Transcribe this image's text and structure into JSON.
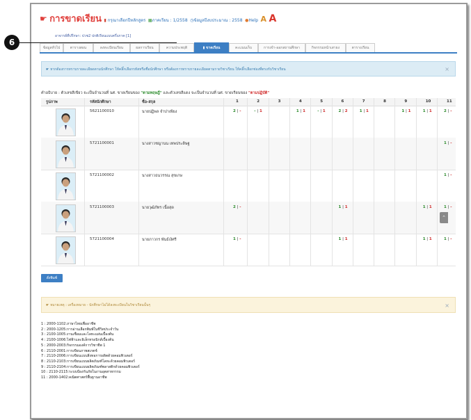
{
  "header": {
    "title": "การขาดเรียน",
    "link_course": "กรุณาเลือกปีหลักสูตร",
    "link_term": "ภาคเรียน : 1/2558",
    "link_year": "ข้อมูลปีงบประมาณ : 2558",
    "help": "Help",
    "font_small": "A",
    "font_large": "A",
    "teacher_line": "อาจารย์ที่ปรึกษา: ปวช2 ปกติเรียนแบบครึ่งภาค [1]"
  },
  "tabs": [
    {
      "label": "ข้อมูลทั่วไป"
    },
    {
      "label": "ตารางสอน"
    },
    {
      "label": "ลงทะเบียนเรียน"
    },
    {
      "label": "ผลการเรียน"
    },
    {
      "label": "ความประพฤติ"
    },
    {
      "label": "ขาดเรียน"
    },
    {
      "label": "คะแนนเก็บ"
    },
    {
      "label": "การเข้า-ออกสถานศึกษา"
    },
    {
      "label": "กิจกรรมหน้าเสาธง"
    },
    {
      "label": "ตารางเรียน"
    }
  ],
  "marker": "6",
  "info_text": "หากต้องการทราบรายละเอียดตามนักศึกษา ให้คลิ๊กเลือกรหัสหรือชื่อนักศึกษา หรือต้องการทราบรายละเอียดตามรายวิชาเรียน ให้คลิ๊กเลือกช่องที่ตรงกับวิชาเรียน",
  "desc": {
    "prefix": "คำอธิบาย : ตัวเลขสีเขียว จะเป็นจำนวนที่ นศ. ขาดเรียนของ ",
    "green_word": "\"ตามทฤษฎี\"",
    "middle": " และตัวเลขสีแดง จะเป็นจำนวนที่ นศ. ขาดเรียนของ ",
    "red_word": "\"ตามปฏิบัติ\""
  },
  "table": {
    "headers": {
      "photo": "รูปภาพ",
      "id": "รหัสนักศึกษา",
      "name": "ชื่อ-สกุล"
    },
    "subjects": [
      "1",
      "2",
      "3",
      "4",
      "5",
      "6",
      "7",
      "8",
      "9",
      "10",
      "11"
    ],
    "rows": [
      {
        "id": "5621100010",
        "name": "นายปฏิพล จำปาเพียง",
        "att": {
          "1": [
            "2",
            "-"
          ],
          "2": [
            "-",
            "1"
          ],
          "4": [
            "1",
            "1"
          ],
          "5": [
            "-",
            "1"
          ],
          "6": [
            "2",
            "2"
          ],
          "7": [
            "1",
            "1"
          ],
          "9": [
            "1",
            "1"
          ],
          "10": [
            "1",
            "1"
          ],
          "11": [
            "2",
            "-"
          ]
        }
      },
      {
        "id": "5721100001",
        "name": "นางสาวชญานน เทพประดิษฐ",
        "att": {
          "11": [
            "1",
            "-"
          ]
        }
      },
      {
        "id": "5721100002",
        "name": "นางสาวธนวรรณ สุขเกษ",
        "att": {
          "11": [
            "1",
            "-"
          ]
        }
      },
      {
        "id": "5721100003",
        "name": "นายวุฒิภัทร เนื้อสุด",
        "att": {
          "1": [
            "2",
            "-"
          ],
          "6": [
            "1",
            "1"
          ],
          "10": [
            "1",
            "1"
          ],
          "11": [
            "1",
            "-"
          ]
        }
      },
      {
        "id": "5721100004",
        "name": "นายภาวกร พันธ์เงิศรี",
        "att": {
          "1": [
            "1",
            "-"
          ],
          "6": [
            "1",
            "1"
          ],
          "10": [
            "1",
            "1"
          ],
          "11": [
            "1",
            "-"
          ]
        }
      }
    ]
  },
  "print_button": "สั่งพิมพ์",
  "warning_text": "หมายเหตุ : เครื่องหมาย - นักศึกษาไม่ได้ลงทะเบียนในวิชาเรียนนั้นๆ",
  "legend": [
    "1 : 2000-1102:ภาษาไทยเพื่ออาชีพ",
    "2 : 2000-1205:การอ่านเลือกพิมพ์ในชีวิตประจำวัน",
    "3 : 2100-1005:งานเชื่อมและโลหะแผ่นเบื้องต้น",
    "4 : 2100-1006:ไฟฟ้าและอิเล็กทรอนิกส์เบื้องต้น",
    "5 : 2000-2003:กิจกรรมองค์การวิชาชีพ 1",
    "6 : 2110-2001:การเขียนภาพสเกตช์",
    "7 : 2110-2006:การเขียนแบบสิ่งทอการผลิตด้วยคอมพิวเตอร์",
    "8 : 2110-2103:การเขียนแบบผลิตภัณฑ์โลหะด้วยคอมพิวเตอร์",
    "9 : 2110-2104:การเขียนแบบผลิตภัณฑ์พลาสติกด้วยคอมพิวเตอร์",
    "10 : 2110-2115:ระบบป้องกันภัยในงานอุตสาหกรรม",
    "11 : 2000-1402:คณิตศาสตร์พื้นฐานอาชีพ"
  ],
  "colors": {
    "primary": "#3d7fc4",
    "theory": "#2a8a2a",
    "practice": "#d02b2b",
    "title": "#e0403c"
  }
}
